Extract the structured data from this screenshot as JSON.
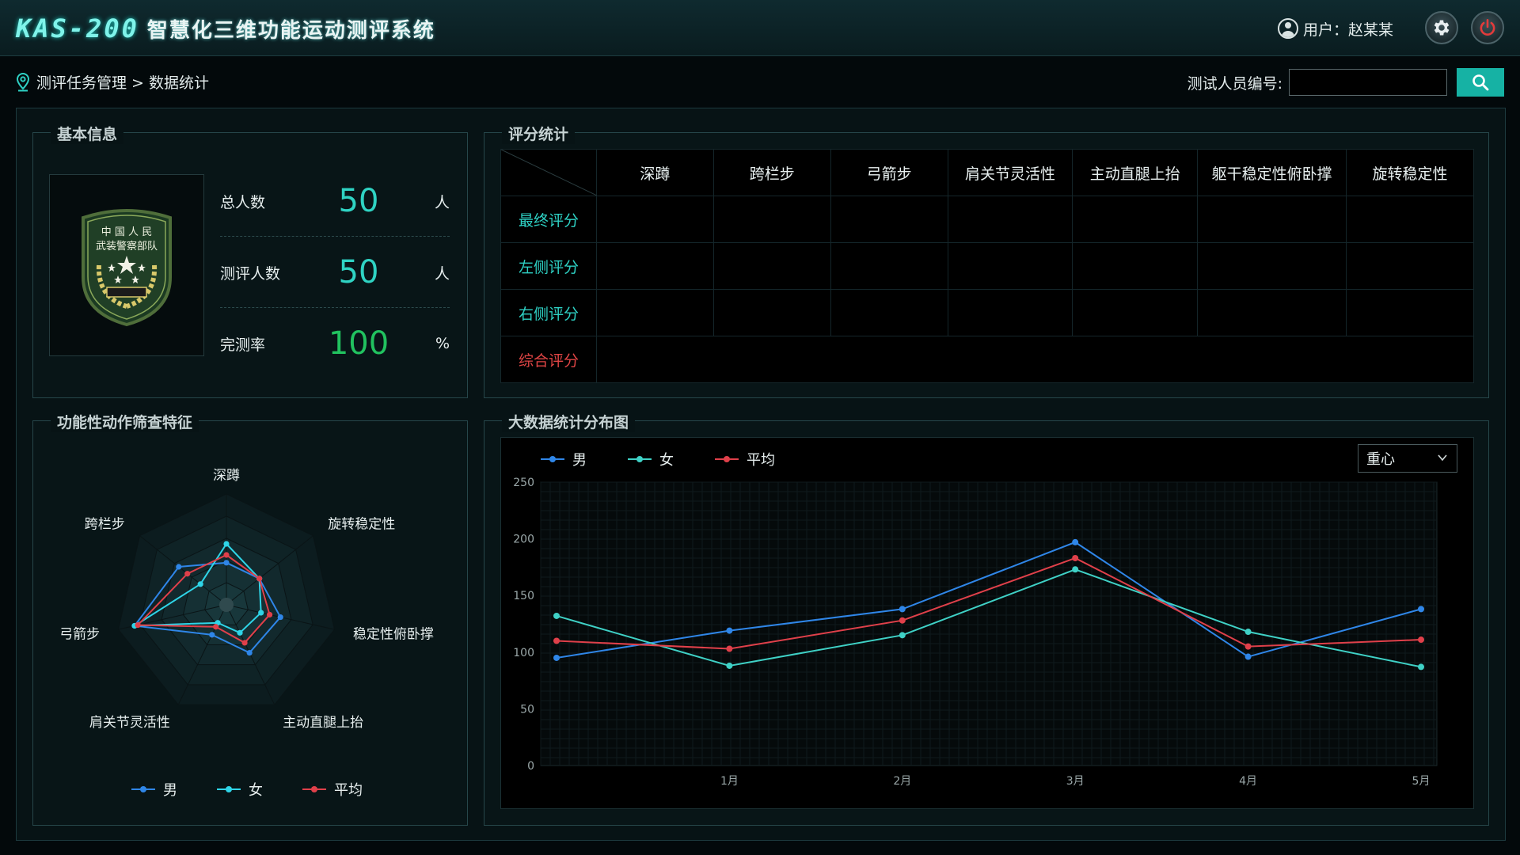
{
  "app": {
    "code": "KAS-200",
    "name": "智慧化三维功能运动测评系统",
    "user_label": "用户：赵某某"
  },
  "icons": {
    "user": "user-icon",
    "settings": "gear-icon",
    "power": "power-icon",
    "location": "location-pin-icon",
    "search": "search-icon",
    "emblem": "armed-police-emblem"
  },
  "breadcrumb": "测评任务管理 > 数据统计",
  "search": {
    "label": "测试人员编号:",
    "value": ""
  },
  "basic": {
    "title": "基本信息",
    "emblem_text": [
      "中 国 人 民",
      "武装警察部队"
    ],
    "stats": [
      {
        "label": "总人数",
        "value": "50",
        "unit": "人",
        "color": "#2fd3c3"
      },
      {
        "label": "测评人数",
        "value": "50",
        "unit": "人",
        "color": "#2fd3c3"
      },
      {
        "label": "完测率",
        "value": "100",
        "unit": "%",
        "color": "#21c25f"
      }
    ]
  },
  "score": {
    "title": "评分统计",
    "columns": [
      "深蹲",
      "跨栏步",
      "弓箭步",
      "肩关节灵活性",
      "主动直腿上抬",
      "躯干稳定性俯卧撑",
      "旋转稳定性"
    ],
    "rows": [
      {
        "label": "最终评分",
        "color": "#2ed1c4"
      },
      {
        "label": "左侧评分",
        "color": "#2ed1c4"
      },
      {
        "label": "右侧评分",
        "color": "#2ed1c4"
      },
      {
        "label": "综合评分",
        "color": "#e04545"
      }
    ]
  },
  "radar": {
    "title": "功能性动作筛查特征",
    "axes": [
      "深蹲",
      "旋转稳定性",
      "稳定性俯卧撑",
      "主动直腿上抬",
      "肩关节灵活性",
      "弓箭步",
      "跨栏步"
    ],
    "max": 100,
    "series": [
      {
        "name": "男",
        "color": "#2f86e8",
        "values": [
          38,
          38,
          50,
          48,
          30,
          85,
          55
        ]
      },
      {
        "name": "女",
        "color": "#2fd5e8",
        "values": [
          55,
          38,
          32,
          28,
          18,
          85,
          30
        ]
      },
      {
        "name": "平均",
        "color": "#e0404a",
        "values": [
          45,
          38,
          40,
          38,
          22,
          82,
          45
        ]
      }
    ]
  },
  "bigdata": {
    "title": "大数据统计分布图",
    "select_value": "重心",
    "chart_data": {
      "type": "line",
      "x": [
        "",
        "1月",
        "2月",
        "3月",
        "4月",
        "5月"
      ],
      "ylim": [
        0,
        250
      ],
      "yticks": [
        0,
        50,
        100,
        150,
        200,
        250
      ],
      "grid": true,
      "legend": "top-left",
      "series": [
        {
          "name": "男",
          "color": "#2f86e8",
          "values": [
            95,
            119,
            138,
            197,
            96,
            138
          ]
        },
        {
          "name": "女",
          "color": "#3fd1c6",
          "values": [
            132,
            88,
            115,
            173,
            118,
            87
          ]
        },
        {
          "name": "平均",
          "color": "#e0404a",
          "values": [
            110,
            103,
            128,
            183,
            105,
            111
          ]
        }
      ]
    }
  }
}
